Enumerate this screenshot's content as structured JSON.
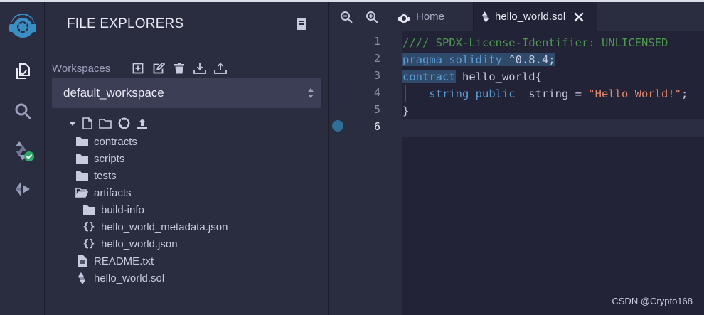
{
  "rail": {
    "items": [
      "remix-logo-icon",
      "file-explorer-icon",
      "search-icon",
      "solidity-compiler-icon",
      "deploy-run-icon"
    ]
  },
  "explorer": {
    "title": "FILE EXPLORERS",
    "workspaces_label": "Workspaces",
    "workspace_selected": "default_workspace",
    "tree": [
      {
        "label": "contracts",
        "kind": "folder",
        "depth": 0
      },
      {
        "label": "scripts",
        "kind": "folder",
        "depth": 0
      },
      {
        "label": "tests",
        "kind": "folder",
        "depth": 0
      },
      {
        "label": "artifacts",
        "kind": "folder-open",
        "depth": 0
      },
      {
        "label": "build-info",
        "kind": "folder",
        "depth": 1
      },
      {
        "label": "hello_world_metadata.json",
        "kind": "json",
        "depth": 1
      },
      {
        "label": "hello_world.json",
        "kind": "json",
        "depth": 1
      },
      {
        "label": "README.txt",
        "kind": "file",
        "depth": 0
      },
      {
        "label": "hello_world.sol",
        "kind": "solidity",
        "depth": 0
      }
    ]
  },
  "editor": {
    "tabs": [
      {
        "label": "Home"
      },
      {
        "label": "hello_world.sol"
      }
    ],
    "line_numbers": [
      "1",
      "2",
      "3",
      "4",
      "5",
      "6"
    ],
    "lines": {
      "l1": "//// SPDX-License-Identifier: UNLICENSED",
      "l2a": "pragma solidity",
      "l2b": " ^0.8.4;",
      "l3a": "contract",
      "l3b": " hello_world{",
      "l4a": "    string public",
      "l4b": " _string = ",
      "l4c": "\"Hello World!\"",
      "l4d": ";",
      "l5": "}"
    }
  },
  "watermark": "CSDN @Crypto168"
}
